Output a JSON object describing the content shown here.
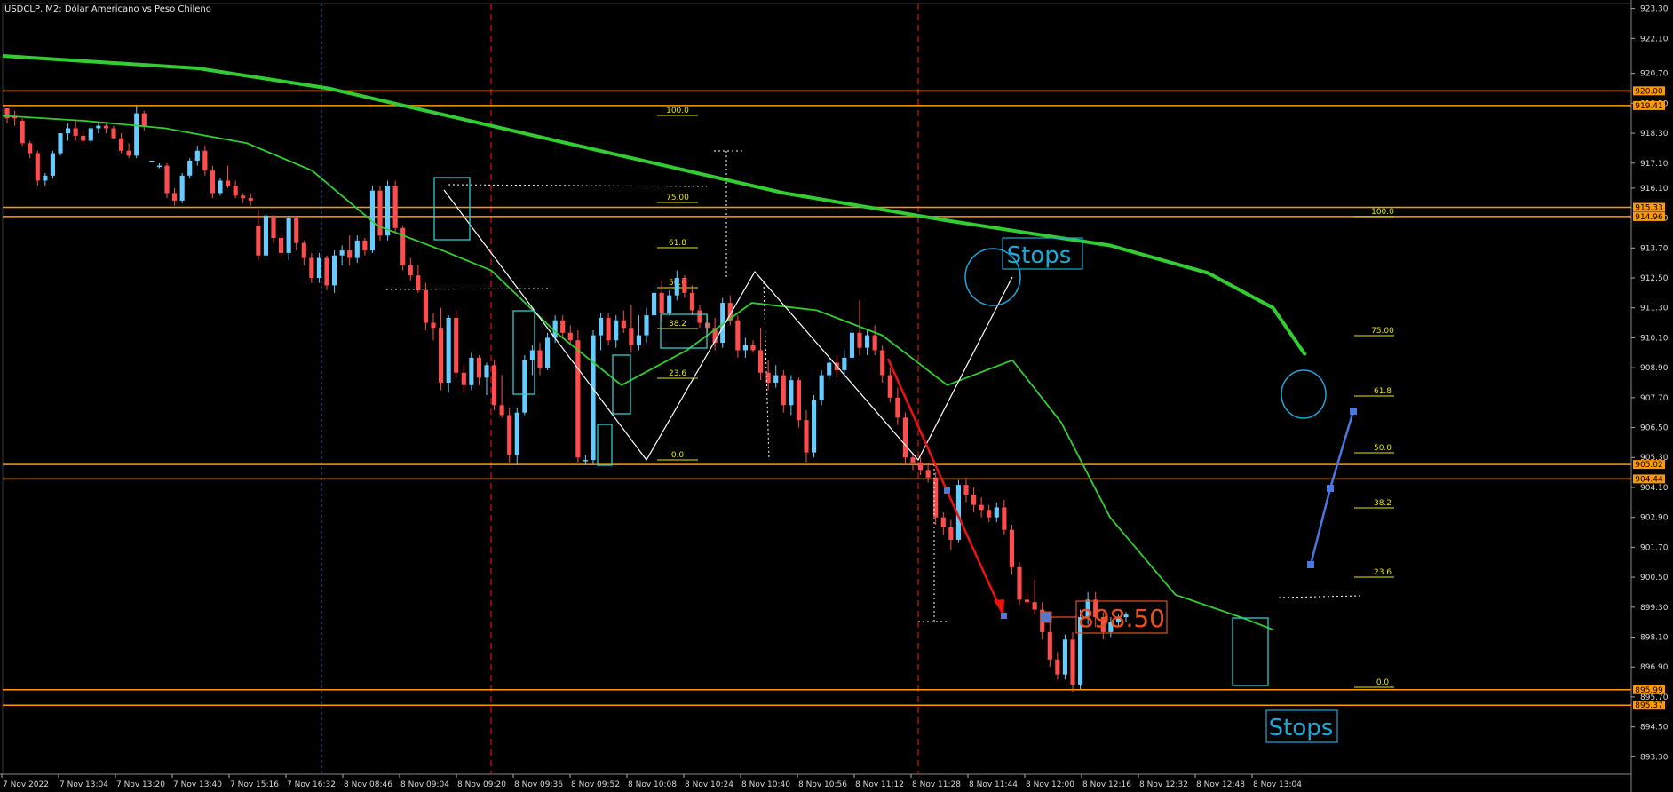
{
  "chart_data": {
    "type": "candlestick",
    "title": "USDCLP, M2:  Dólar Americano vs Peso Chileno",
    "y_ticks": [
      "923.30",
      "922.10",
      "920.70",
      "919.50",
      "918.30",
      "917.10",
      "916.10",
      "914.90",
      "913.70",
      "912.50",
      "911.30",
      "910.10",
      "908.90",
      "907.70",
      "906.50",
      "905.30",
      "904.10",
      "902.90",
      "901.70",
      "900.50",
      "899.30",
      "898.10",
      "896.90",
      "895.70",
      "894.50",
      "893.30"
    ],
    "x_ticks": [
      "7 Nov 2022",
      "7 Nov 13:04",
      "7 Nov 13:20",
      "7 Nov 13:40",
      "7 Nov 15:16",
      "7 Nov 16:32",
      "8 Nov 08:46",
      "8 Nov 09:04",
      "8 Nov 09:20",
      "8 Nov 09:36",
      "8 Nov 09:52",
      "8 Nov 10:08",
      "8 Nov 10:24",
      "8 Nov 10:40",
      "8 Nov 10:56",
      "8 Nov 11:12",
      "8 Nov 11:28",
      "8 Nov 11:44",
      "8 Nov 12:00",
      "8 Nov 12:16",
      "8 Nov 12:32",
      "8 Nov 12:48",
      "8 Nov 13:04"
    ],
    "ylim": [
      892.6,
      923.5
    ],
    "horizontal_levels": [
      {
        "label": "920.00",
        "value": 920.0,
        "color": "#ff9900"
      },
      {
        "label": "919.41",
        "value": 919.41,
        "color": "#ff9900"
      },
      {
        "label": "915.33",
        "value": 915.33,
        "color": "#ff9900"
      },
      {
        "label": "914.96",
        "value": 914.96,
        "color": "#ff9900"
      },
      {
        "label": "905.02",
        "value": 905.02,
        "color": "#ff9900"
      },
      {
        "label": "904.44",
        "value": 904.44,
        "color": "#ff9900"
      },
      {
        "label": "895.99",
        "value": 895.99,
        "color": "#ff9900"
      },
      {
        "label": "895.37",
        "value": 895.37,
        "color": "#ff9900"
      }
    ],
    "fib_left": [
      "100.0",
      "75.00",
      "61.8",
      "50.0",
      "38.2",
      "23.6",
      "0.0"
    ],
    "fib_right": [
      "100.0",
      "75.00",
      "61.8",
      "50.0",
      "38.2",
      "23.6",
      "0.0"
    ],
    "ma200_color": "#33cc33",
    "ma20_color": "#33cc33",
    "bull_color": "#66ccff",
    "bear_color": "#ff4d4d",
    "candles_ohlc": [
      [
        919.3,
        919.3,
        918.7,
        918.9
      ],
      [
        919.0,
        919.2,
        918.6,
        918.9
      ],
      [
        918.8,
        918.9,
        917.8,
        917.9
      ],
      [
        917.9,
        918.0,
        917.3,
        917.5
      ],
      [
        917.5,
        917.6,
        916.2,
        916.4
      ],
      [
        916.4,
        916.7,
        916.2,
        916.6
      ],
      [
        916.6,
        917.6,
        916.5,
        917.5
      ],
      [
        917.5,
        918.3,
        917.4,
        918.3
      ],
      [
        918.3,
        918.7,
        918.0,
        918.5
      ],
      [
        918.5,
        918.8,
        918.0,
        918.2
      ],
      [
        918.2,
        918.4,
        917.9,
        918.0
      ],
      [
        918.0,
        918.6,
        917.9,
        918.5
      ],
      [
        918.5,
        918.7,
        918.3,
        918.6
      ],
      [
        918.6,
        918.7,
        918.3,
        918.5
      ],
      [
        918.5,
        918.6,
        918.1,
        918.1
      ],
      [
        918.1,
        918.3,
        917.5,
        917.6
      ],
      [
        917.6,
        917.9,
        917.3,
        917.4
      ],
      [
        917.4,
        919.4,
        917.3,
        919.1
      ],
      [
        919.1,
        919.2,
        918.4,
        918.6
      ],
      [
        917.2,
        917.2,
        917.2,
        917.2
      ],
      [
        917.0,
        917.1,
        916.9,
        917.0
      ],
      [
        917.0,
        917.1,
        915.7,
        915.9
      ],
      [
        915.9,
        916.1,
        915.4,
        915.6
      ],
      [
        915.6,
        916.7,
        915.5,
        916.6
      ],
      [
        916.6,
        917.3,
        916.5,
        917.2
      ],
      [
        917.2,
        917.8,
        917.0,
        917.6
      ],
      [
        917.6,
        917.8,
        916.6,
        916.8
      ],
      [
        916.8,
        917.0,
        915.7,
        915.9
      ],
      [
        915.9,
        916.5,
        915.8,
        916.4
      ],
      [
        916.4,
        917.0,
        916.1,
        916.2
      ],
      [
        916.2,
        916.4,
        915.7,
        915.8
      ],
      [
        915.8,
        915.9,
        915.5,
        915.7
      ],
      [
        915.7,
        915.9,
        915.4,
        915.6
      ],
      [
        914.6,
        915.2,
        913.2,
        913.4
      ],
      [
        913.4,
        915.1,
        913.2,
        915.0
      ],
      [
        915.0,
        915.0,
        913.9,
        914.1
      ],
      [
        914.1,
        914.3,
        913.3,
        913.5
      ],
      [
        913.5,
        915.0,
        913.2,
        914.9
      ],
      [
        914.9,
        915.0,
        913.6,
        913.9
      ],
      [
        913.9,
        914.0,
        913.0,
        913.3
      ],
      [
        913.3,
        913.5,
        912.3,
        912.5
      ],
      [
        912.5,
        913.5,
        912.3,
        913.3
      ],
      [
        913.3,
        913.4,
        912.0,
        912.2
      ],
      [
        912.2,
        913.6,
        911.9,
        913.4
      ],
      [
        913.4,
        913.8,
        913.0,
        913.6
      ],
      [
        913.6,
        914.2,
        913.0,
        913.3
      ],
      [
        913.3,
        914.2,
        913.1,
        914.0
      ],
      [
        914.0,
        914.1,
        913.4,
        913.6
      ],
      [
        913.6,
        916.2,
        913.5,
        916.0
      ],
      [
        916.0,
        916.2,
        914.0,
        914.2
      ],
      [
        914.2,
        916.4,
        914.0,
        916.2
      ],
      [
        916.2,
        916.4,
        914.3,
        914.5
      ],
      [
        914.5,
        914.6,
        912.8,
        913.0
      ],
      [
        913.0,
        913.3,
        912.4,
        912.6
      ],
      [
        912.6,
        913.0,
        911.9,
        912.0
      ],
      [
        912.0,
        912.3,
        910.4,
        910.7
      ],
      [
        910.7,
        911.1,
        910.0,
        910.5
      ],
      [
        910.5,
        911.3,
        908.0,
        908.3
      ],
      [
        908.3,
        911.0,
        907.9,
        910.9
      ],
      [
        910.9,
        911.2,
        908.5,
        908.7
      ],
      [
        908.7,
        909.0,
        907.9,
        908.2
      ],
      [
        908.2,
        909.5,
        908.0,
        909.3
      ],
      [
        909.3,
        909.4,
        908.2,
        908.5
      ],
      [
        908.5,
        909.1,
        907.8,
        909.0
      ],
      [
        909.0,
        909.2,
        907.2,
        907.4
      ],
      [
        907.4,
        908.6,
        906.9,
        907.0
      ],
      [
        907.0,
        907.3,
        905.1,
        905.4
      ],
      [
        905.4,
        907.3,
        905.0,
        907.1
      ],
      [
        907.1,
        909.4,
        907.0,
        909.2
      ],
      [
        909.2,
        909.8,
        908.6,
        909.6
      ],
      [
        909.6,
        909.9,
        908.6,
        908.9
      ],
      [
        908.9,
        910.3,
        908.8,
        910.1
      ],
      [
        910.1,
        911.0,
        909.9,
        910.8
      ],
      [
        910.8,
        911.0,
        910.1,
        910.3
      ],
      [
        910.3,
        910.6,
        909.8,
        910.0
      ],
      [
        910.0,
        910.4,
        905.1,
        905.3
      ],
      [
        905.2,
        905.4,
        905.0,
        905.2
      ],
      [
        905.2,
        910.4,
        905.0,
        910.2
      ],
      [
        910.2,
        911.1,
        909.6,
        910.9
      ],
      [
        910.9,
        911.1,
        909.8,
        910.0
      ],
      [
        910.0,
        911.0,
        909.7,
        910.8
      ],
      [
        910.8,
        911.2,
        910.3,
        910.5
      ],
      [
        910.5,
        911.4,
        909.5,
        909.8
      ],
      [
        909.8,
        911.0,
        909.6,
        910.2
      ],
      [
        910.2,
        911.3,
        909.9,
        911.0
      ],
      [
        911.0,
        912.1,
        911.0,
        911.9
      ],
      [
        911.9,
        912.4,
        910.8,
        911.1
      ],
      [
        911.1,
        912.0,
        911.0,
        911.8
      ],
      [
        911.8,
        912.8,
        911.6,
        912.5
      ],
      [
        912.5,
        912.6,
        911.7,
        911.9
      ],
      [
        911.9,
        912.2,
        911.0,
        911.2
      ],
      [
        911.2,
        911.4,
        910.5,
        910.7
      ],
      [
        910.7,
        911.0,
        910.3,
        910.5
      ],
      [
        910.5,
        910.9,
        909.6,
        909.9
      ],
      [
        909.9,
        911.7,
        909.7,
        911.5
      ],
      [
        911.5,
        911.8,
        910.6,
        910.8
      ],
      [
        910.8,
        911.0,
        909.3,
        909.6
      ],
      [
        909.6,
        910.1,
        909.3,
        909.8
      ],
      [
        909.8,
        910.0,
        909.5,
        909.6
      ],
      [
        909.6,
        910.5,
        908.4,
        908.7
      ],
      [
        908.7,
        909.2,
        908.0,
        908.3
      ],
      [
        908.3,
        909.0,
        908.1,
        908.6
      ],
      [
        908.6,
        908.8,
        907.1,
        907.4
      ],
      [
        907.4,
        908.6,
        907.0,
        908.4
      ],
      [
        908.4,
        908.5,
        906.5,
        906.8
      ],
      [
        906.8,
        907.2,
        905.1,
        905.5
      ],
      [
        905.5,
        907.8,
        905.3,
        907.6
      ],
      [
        907.6,
        908.8,
        907.4,
        908.6
      ],
      [
        908.6,
        909.3,
        908.4,
        909.1
      ],
      [
        909.1,
        909.4,
        908.5,
        908.8
      ],
      [
        908.8,
        909.6,
        908.5,
        909.3
      ],
      [
        909.3,
        910.5,
        909.2,
        910.3
      ],
      [
        910.3,
        911.6,
        909.4,
        909.7
      ],
      [
        909.7,
        910.4,
        909.4,
        910.2
      ],
      [
        910.2,
        910.6,
        909.4,
        909.6
      ],
      [
        909.6,
        909.8,
        908.3,
        908.6
      ],
      [
        908.6,
        908.9,
        907.5,
        907.7
      ],
      [
        907.7,
        908.1,
        906.6,
        906.9
      ],
      [
        906.9,
        907.1,
        905.0,
        905.3
      ],
      [
        905.3,
        905.5,
        904.8,
        905.1
      ],
      [
        905.1,
        905.3,
        904.6,
        904.8
      ],
      [
        904.8,
        905.1,
        904.3,
        904.5
      ],
      [
        904.5,
        904.7,
        902.6,
        902.9
      ],
      [
        902.9,
        903.1,
        902.2,
        902.5
      ],
      [
        902.5,
        902.8,
        901.6,
        902.0
      ],
      [
        902.0,
        904.4,
        901.9,
        904.2
      ],
      [
        904.2,
        904.5,
        903.5,
        903.8
      ],
      [
        903.8,
        904.1,
        903.1,
        903.4
      ],
      [
        903.4,
        903.7,
        902.9,
        903.2
      ],
      [
        903.2,
        903.4,
        902.7,
        902.9
      ],
      [
        902.9,
        903.5,
        902.7,
        903.3
      ],
      [
        903.3,
        903.6,
        902.2,
        902.4
      ],
      [
        902.4,
        902.6,
        900.6,
        900.9
      ],
      [
        900.9,
        901.1,
        899.4,
        899.6
      ],
      [
        899.6,
        899.9,
        899.2,
        899.5
      ],
      [
        899.5,
        900.4,
        899.0,
        899.2
      ],
      [
        899.2,
        899.5,
        898.0,
        898.3
      ],
      [
        898.3,
        898.8,
        896.9,
        897.2
      ],
      [
        897.2,
        897.5,
        896.4,
        896.6
      ],
      [
        896.6,
        898.2,
        896.4,
        898.0
      ],
      [
        898.0,
        898.3,
        895.9,
        896.2
      ],
      [
        896.2,
        899.2,
        896.0,
        898.9
      ],
      [
        898.9,
        899.9,
        898.6,
        899.6
      ],
      [
        899.6,
        899.9,
        898.5,
        898.9
      ],
      [
        898.9,
        899.1,
        898.0,
        898.3
      ],
      [
        898.3,
        898.9,
        898.1,
        898.7
      ],
      [
        898.7,
        899.0,
        898.5,
        898.9
      ],
      [
        898.9,
        899.1,
        898.7,
        899.0
      ]
    ],
    "ma200": [
      [
        0,
        921.4
      ],
      [
        0.12,
        920.9
      ],
      [
        0.2,
        920.1
      ],
      [
        0.28,
        918.9
      ],
      [
        0.38,
        917.4
      ],
      [
        0.48,
        915.9
      ],
      [
        0.58,
        914.8
      ],
      [
        0.68,
        913.8
      ],
      [
        0.74,
        912.7
      ],
      [
        0.78,
        911.3
      ],
      [
        0.8,
        909.4
      ]
    ],
    "ma20": [
      [
        0,
        919.0
      ],
      [
        0.05,
        918.8
      ],
      [
        0.1,
        918.5
      ],
      [
        0.15,
        917.9
      ],
      [
        0.19,
        916.8
      ],
      [
        0.23,
        914.6
      ],
      [
        0.27,
        913.6
      ],
      [
        0.3,
        912.8
      ],
      [
        0.34,
        910.3
      ],
      [
        0.38,
        908.2
      ],
      [
        0.42,
        909.6
      ],
      [
        0.46,
        911.5
      ],
      [
        0.5,
        911.2
      ],
      [
        0.54,
        910.2
      ],
      [
        0.58,
        908.2
      ],
      [
        0.62,
        909.2
      ],
      [
        0.65,
        906.7
      ],
      [
        0.68,
        902.9
      ],
      [
        0.72,
        899.8
      ],
      [
        0.76,
        898.9
      ],
      [
        0.78,
        898.4
      ]
    ],
    "annotations": {
      "stops_top": "Stops",
      "stops_bottom": "Stops",
      "price_label": "898.50"
    }
  }
}
